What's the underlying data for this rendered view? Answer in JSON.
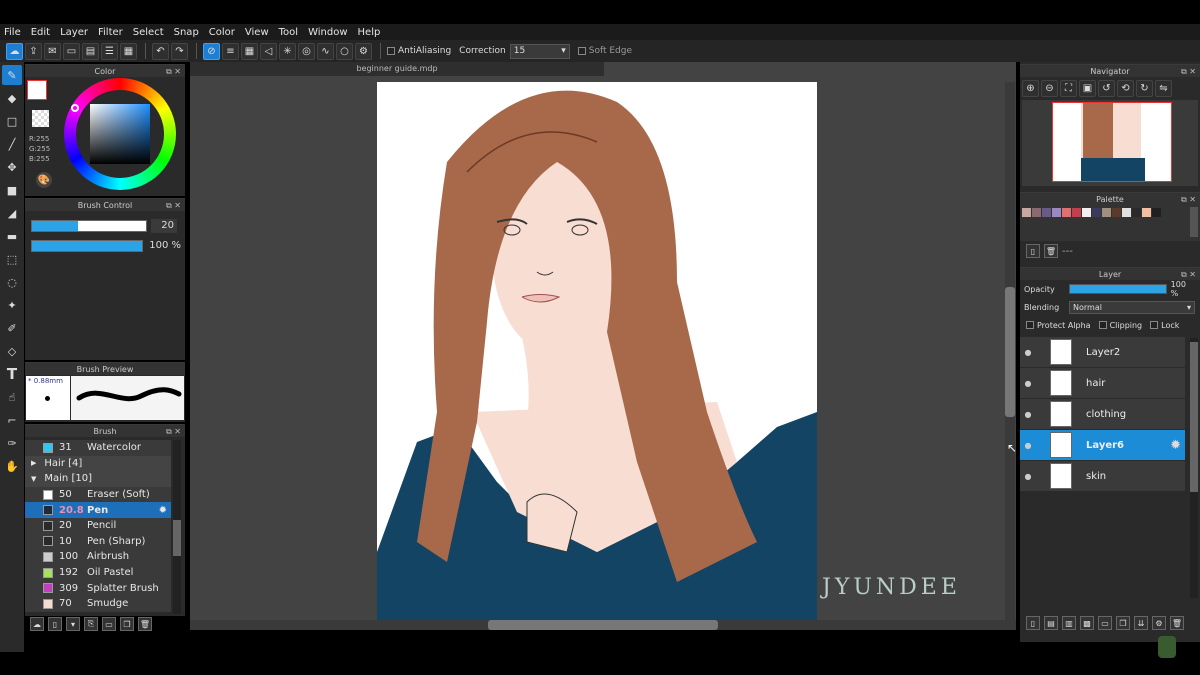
{
  "menu": [
    "File",
    "Edit",
    "Layer",
    "Filter",
    "Select",
    "Snap",
    "Color",
    "View",
    "Tool",
    "Window",
    "Help"
  ],
  "toolbar": {
    "antialiasing_label": "AntiAliasing",
    "correction_label": "Correction",
    "correction_value": "15",
    "soft_edge_label": "Soft Edge"
  },
  "document": {
    "title": "beginner guide.mdp"
  },
  "color_panel": {
    "title": "Color",
    "rgb": [
      "R:255",
      "G:255",
      "B:255"
    ]
  },
  "brush_control": {
    "title": "Brush Control",
    "size": "20",
    "opacity": "100 %"
  },
  "brush_preview": {
    "title": "Brush Preview",
    "size_label": "* 0.88mm"
  },
  "brush_panel": {
    "title": "Brush",
    "rows": [
      {
        "num": "31",
        "name": "Watercolor",
        "color": "#2ec8f0"
      },
      {
        "num": "",
        "name": "Hair [4]",
        "group": true
      },
      {
        "num": "",
        "name": "Main [10]",
        "group": true,
        "open": true
      },
      {
        "num": "50",
        "name": "Eraser (Soft)",
        "color": "#ffffff"
      },
      {
        "num": "20.8",
        "name": "Pen",
        "color": "#1e2a3a",
        "selected": true
      },
      {
        "num": "20",
        "name": "Pencil",
        "color": "#2a2a2a"
      },
      {
        "num": "10",
        "name": "Pen (Sharp)",
        "color": "#2a2a2a"
      },
      {
        "num": "100",
        "name": "Airbrush",
        "color": "#cccccc"
      },
      {
        "num": "192",
        "name": "Oil Pastel",
        "color": "#a8e060"
      },
      {
        "num": "309",
        "name": "Splatter Brush",
        "color": "#c040c0"
      },
      {
        "num": "70",
        "name": "Smudge",
        "color": "#f5dcd0"
      }
    ]
  },
  "navigator": {
    "title": "Navigator"
  },
  "palette": {
    "title": "Palette",
    "page": "---",
    "colors": [
      "#c8a7a0",
      "#8a6a70",
      "#6a5a8a",
      "#9a88c0",
      "#e07070",
      "#c04050",
      "#f0f0f0",
      "#3a3a5a",
      "#a09080",
      "#5a3a2a",
      "#e0e0e0",
      "#2a2a2a",
      "#f0c0a0",
      "#202020"
    ]
  },
  "layer_panel": {
    "title": "Layer",
    "opacity_label": "Opacity",
    "opacity_value": "100 %",
    "opacity_fraction": 1.0,
    "blending_label": "Blending",
    "blending_value": "Normal",
    "protect_alpha": "Protect Alpha",
    "clipping": "Clipping",
    "lock": "Lock",
    "layers": [
      {
        "name": "Layer2"
      },
      {
        "name": "hair"
      },
      {
        "name": "clothing"
      },
      {
        "name": "Layer6",
        "selected": true
      },
      {
        "name": "skin"
      }
    ]
  },
  "watermark": "JYUNDEE"
}
